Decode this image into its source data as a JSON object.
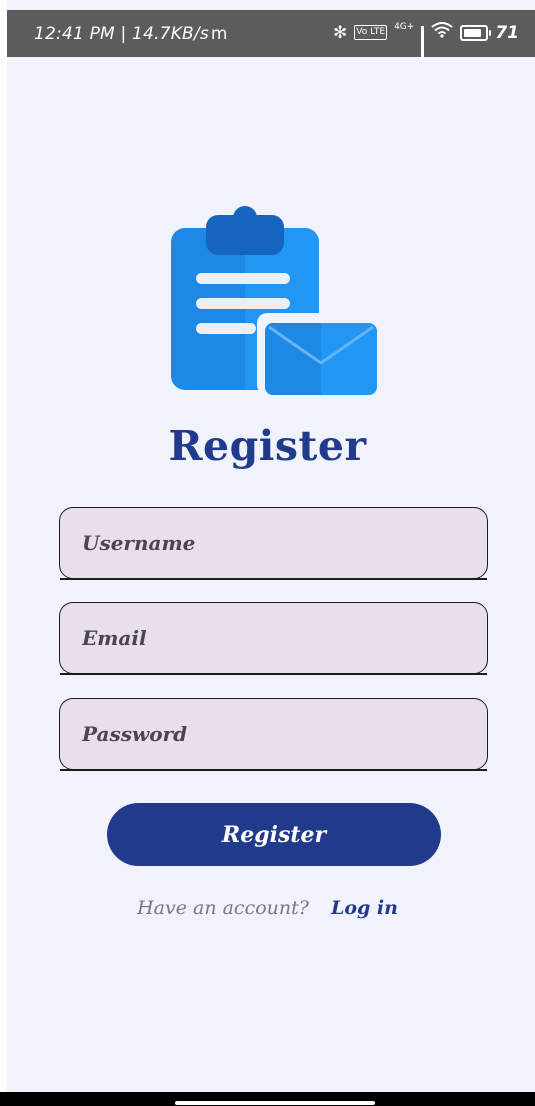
{
  "status_bar": {
    "time_speed": "12:41 PM | 14.7KB/s",
    "carrier_glyph": "m",
    "network_label": "4G+",
    "volte_label": "Vo LTE",
    "battery_level": "71"
  },
  "logo": {
    "icon": "clipboard-with-envelope-icon",
    "colors": {
      "clipboard": "#1e88e5",
      "clipboard_dark": "#1565c0",
      "paper_lines": "#eceff1",
      "envelope": "#2196f3"
    }
  },
  "title": "Register",
  "form": {
    "username_placeholder": "Username",
    "email_placeholder": "Email",
    "password_placeholder": "Password"
  },
  "register_button_label": "Register",
  "login": {
    "prompt": "Have an account?",
    "link_label": "Log in"
  },
  "colors": {
    "accent": "#213a8c",
    "background": "#f0f3fb",
    "field_fill": "#e8dfeb",
    "status_bar": "#5c5c5c"
  }
}
